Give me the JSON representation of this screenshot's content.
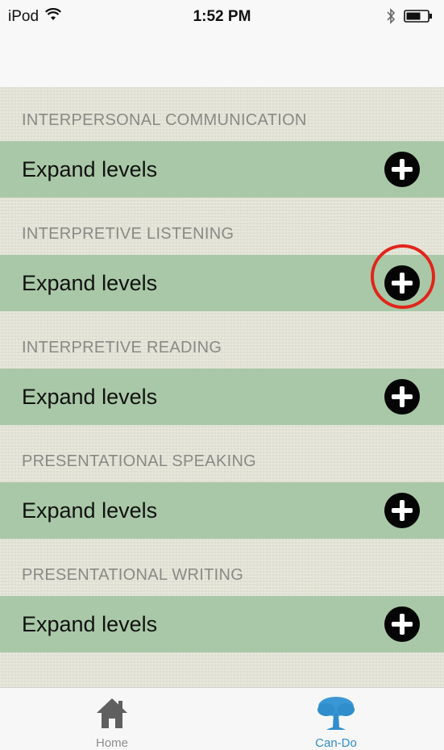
{
  "status_bar": {
    "carrier": "iPod",
    "time": "1:52 PM",
    "icons": [
      "wifi-icon",
      "bluetooth-icon",
      "battery-icon"
    ]
  },
  "sections": [
    {
      "title": "INTERPERSONAL COMMUNICATION",
      "expand_label": "Expand levels"
    },
    {
      "title": "INTERPRETIVE LISTENING",
      "expand_label": "Expand levels"
    },
    {
      "title": "INTERPRETIVE READING",
      "expand_label": "Expand levels"
    },
    {
      "title": "PRESENTATIONAL SPEAKING",
      "expand_label": "Expand levels"
    },
    {
      "title": "PRESENTATIONAL WRITING",
      "expand_label": "Expand levels"
    }
  ],
  "tabs": [
    {
      "label": "Home",
      "icon": "home-icon",
      "selected": false,
      "color": "#8f8f8f"
    },
    {
      "label": "Can-Do",
      "icon": "tree-icon",
      "selected": true,
      "color": "#2f8ecb"
    }
  ],
  "colors": {
    "background": "#e3e3d6",
    "row": "#a9c8a7",
    "highlight": "#e1251b"
  }
}
